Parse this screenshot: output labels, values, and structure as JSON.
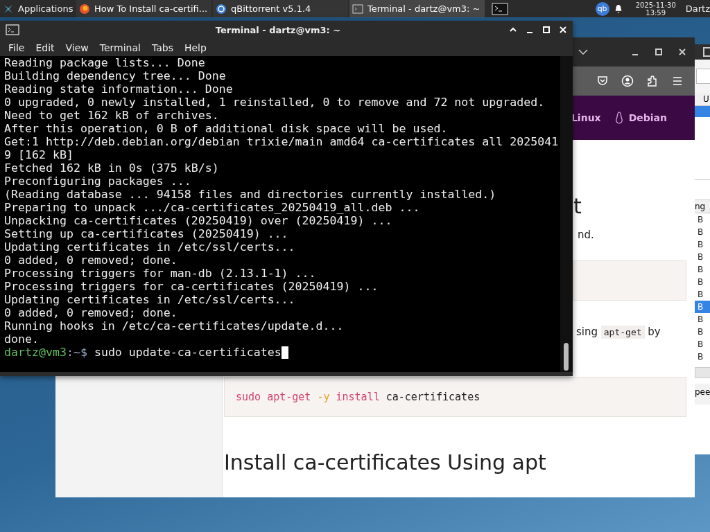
{
  "taskbar": {
    "apps_label": "Applications",
    "tasks": [
      {
        "kind": "browser",
        "label": "How To Install ca-certifi...",
        "selected": false
      },
      {
        "kind": "torrent",
        "label": "qBittorrent v5.1.4",
        "selected": false
      },
      {
        "kind": "terminal",
        "label": "Terminal - dartz@vm3: ~",
        "selected": true
      }
    ],
    "tray_tag": "qb",
    "date": "2025-11-30",
    "time": "13:59",
    "user": "Dartz"
  },
  "terminal": {
    "title": "Terminal - dartz@vm3: ~",
    "menu": [
      "File",
      "Edit",
      "View",
      "Terminal",
      "Tabs",
      "Help"
    ],
    "lines": [
      "Reading package lists... Done",
      "Building dependency tree... Done",
      "Reading state information... Done",
      "0 upgraded, 0 newly installed, 1 reinstalled, 0 to remove and 72 not upgraded.",
      "Need to get 162 kB of archives.",
      "After this operation, 0 B of additional disk space will be used.",
      "Get:1 http://deb.debian.org/debian trixie/main amd64 ca-certificates all 2025041",
      "9 [162 kB]",
      "Fetched 162 kB in 0s (375 kB/s)",
      "Preconfiguring packages ...",
      "(Reading database ... 94158 files and directories currently installed.)",
      "Preparing to unpack .../ca-certificates_20250419_all.deb ...",
      "Unpacking ca-certificates (20250419) over (20250419) ...",
      "Setting up ca-certificates (20250419) ...",
      "Updating certificates in /etc/ssl/certs...",
      "0 added, 0 removed; done.",
      "Processing triggers for man-db (2.13.1-1) ...",
      "Processing triggers for ca-certificates (20250419) ...",
      "Updating certificates in /etc/ssl/certs...",
      "0 added, 0 removed; done.",
      "Running hooks in /etc/ca-certificates/update.d...",
      "done."
    ],
    "prompt": {
      "userhost": "dartz@vm3",
      "path": ":~$",
      "command": "sudo update-ca-certificates"
    }
  },
  "browser": {
    "nav": [
      "Linux",
      "Debian"
    ],
    "heading_fragment": "t",
    "text_fragment": "nd.",
    "sentence_fragment": {
      "before": "sing",
      "code": "apt-get",
      "after": "by"
    },
    "code_block": [
      {
        "text": "sudo",
        "kind": "cmd"
      },
      {
        "text": "apt-get",
        "kind": "cmd"
      },
      {
        "text": "-y",
        "kind": "flag"
      },
      {
        "text": "install",
        "kind": "cmd"
      },
      {
        "text": "ca-certificates",
        "kind": "arg"
      }
    ],
    "heading": "Install ca-certificates Using apt"
  },
  "qbittorrent": {
    "top_header": "U",
    "list_header": "ng",
    "rows": [
      {
        "text": "B",
        "selected": false
      },
      {
        "text": "B",
        "selected": false
      },
      {
        "text": "B",
        "selected": false
      },
      {
        "text": "B",
        "selected": false
      },
      {
        "text": "B",
        "selected": false
      },
      {
        "text": "B",
        "selected": false
      },
      {
        "text": "B",
        "selected": false
      },
      {
        "text": "B",
        "selected": true
      },
      {
        "text": "B",
        "selected": false
      },
      {
        "text": "B",
        "selected": false
      },
      {
        "text": "B",
        "selected": false
      },
      {
        "text": "B",
        "selected": false
      }
    ],
    "bottom_label": "pee"
  }
}
